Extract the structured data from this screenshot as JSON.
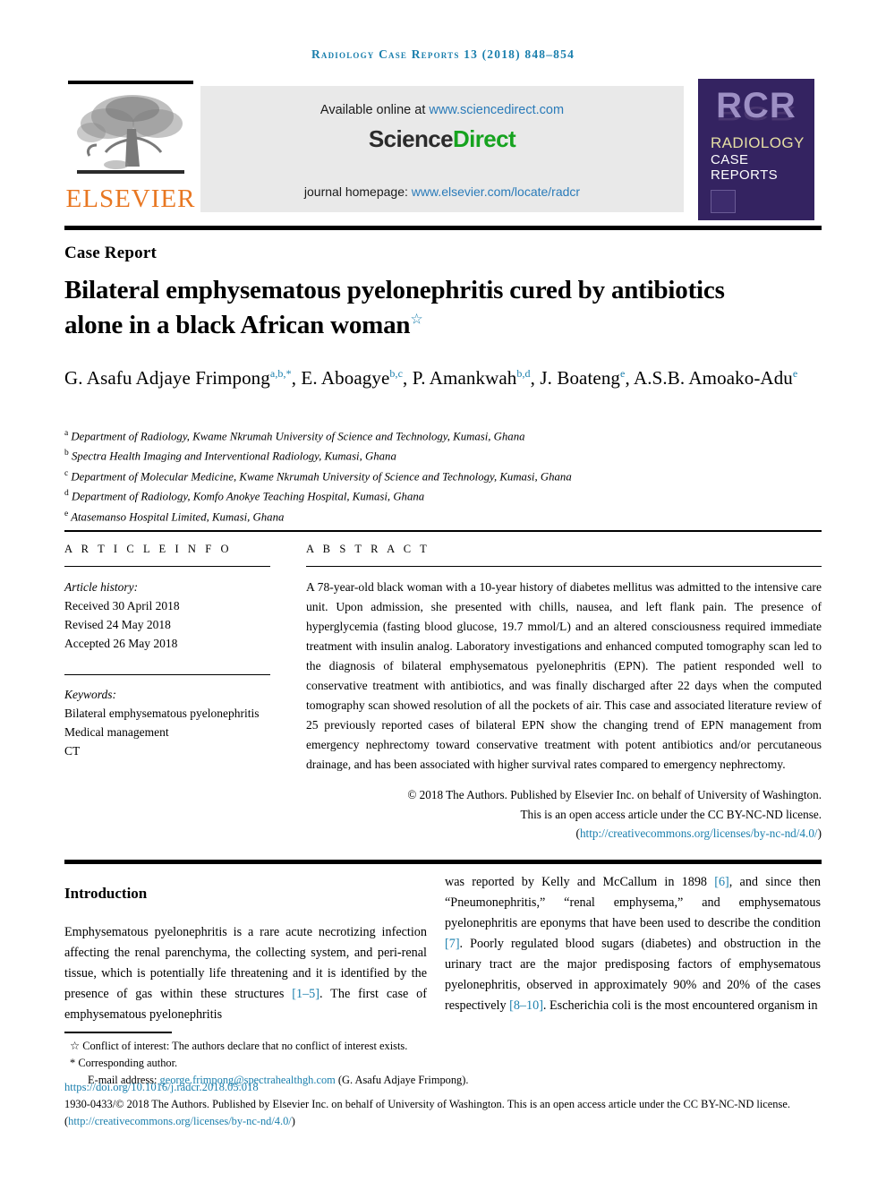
{
  "running_head": "Radiology Case Reports 13 (2018) 848–854",
  "masthead": {
    "elsevier_wordmark": "ELSEVIER",
    "sciencedirect": {
      "available_prefix": "Available online at ",
      "available_link": "www.sciencedirect.com",
      "logo_first": "Science",
      "logo_second": "Direct",
      "homepage_prefix": "journal homepage: ",
      "homepage_link": "www.elsevier.com/locate/radcr"
    },
    "cover": {
      "acronym": "RCR",
      "line1": "RADIOLOGY",
      "line2": "CASE",
      "line3": "REPORTS",
      "bg_color": "#342361",
      "acronym_color": "#9d8fc4",
      "line1_color": "#e6dfa4"
    }
  },
  "article": {
    "doc_type": "Case Report",
    "title": "Bilateral emphysematous pyelonephritis cured by antibiotics alone in a black African woman",
    "title_marker": "☆",
    "authors": [
      {
        "name": "G. Asafu Adjaye Frimpong",
        "marks": "a,b,*"
      },
      {
        "name": "E. Aboagye",
        "marks": "b,c"
      },
      {
        "name": "P. Amankwah",
        "marks": "b,d"
      },
      {
        "name": "J. Boateng",
        "marks": "e"
      },
      {
        "name": "A.S.B. Amoako-Adu",
        "marks": "e"
      }
    ],
    "affiliations": [
      {
        "mark": "a",
        "text": "Department of Radiology, Kwame Nkrumah University of Science and Technology, Kumasi, Ghana"
      },
      {
        "mark": "b",
        "text": "Spectra Health Imaging and Interventional Radiology, Kumasi, Ghana"
      },
      {
        "mark": "c",
        "text": "Department of Molecular Medicine, Kwame Nkrumah University of Science and Technology, Kumasi, Ghana"
      },
      {
        "mark": "d",
        "text": "Department of Radiology, Komfo Anokye Teaching Hospital, Kumasi, Ghana"
      },
      {
        "mark": "e",
        "text": "Atasemanso Hospital Limited, Kumasi, Ghana"
      }
    ]
  },
  "article_info": {
    "heading": "A R T I C L E   I N F O",
    "history_label": "Article history:",
    "received": "Received 30 April 2018",
    "revised": "Revised 24 May 2018",
    "accepted": "Accepted 26 May 2018",
    "keywords_label": "Keywords:",
    "keywords": [
      "Bilateral emphysematous pyelonephritis",
      "Medical management",
      "CT"
    ]
  },
  "abstract": {
    "heading": "A B S T R A C T",
    "text": "A 78-year-old black woman with a 10-year history of diabetes mellitus was admitted to the intensive care unit. Upon admission, she presented with chills, nausea, and left flank pain. The presence of hyperglycemia (fasting blood glucose, 19.7 mmol/L) and an altered consciousness required immediate treatment with insulin analog. Laboratory investigations and enhanced computed tomography scan led to the diagnosis of bilateral emphysematous pyelonephritis (EPN). The patient responded well to conservative treatment with antibiotics, and was finally discharged after 22 days when the computed tomography scan showed resolution of all the pockets of air. This case and associated literature review of 25 previously reported cases of bilateral EPN show the changing trend of EPN management from emergency nephrectomy toward conservative treatment with potent antibiotics and/or percutaneous drainage, and has been associated with higher survival rates compared to emergency nephrectomy.",
    "copyright_line1": "© 2018 The Authors. Published by Elsevier Inc. on behalf of University of Washington.",
    "copyright_line2": "This is an open access article under the CC BY-NC-ND license.",
    "copyright_link_open": "(",
    "copyright_link": "http://creativecommons.org/licenses/by-nc-nd/4.0/",
    "copyright_link_close": ")"
  },
  "body": {
    "intro_heading": "Introduction",
    "left_col": {
      "part1": "Emphysematous pyelonephritis is a rare acute necrotizing infection affecting the renal parenchyma, the collecting system, and peri-renal tissue, which is potentially life threatening and it is identified by the presence of gas within these structures ",
      "cite1": "[1–5]",
      "part2": ". The first case of emphysematous pyelonephritis"
    },
    "right_col": {
      "part1": "was reported by Kelly and McCallum in 1898 ",
      "cite1": "[6]",
      "part2": ", and since then “Pneumonephritis,” “renal emphysema,” and emphysematous pyelonephritis are eponyms that have been used to describe the condition ",
      "cite2": "[7]",
      "part3": ". Poorly regulated blood sugars (diabetes) and obstruction in the urinary tract are the major predisposing factors of emphysematous pyelonephritis, observed in approximately 90% and 20% of the cases respectively ",
      "cite3": "[8–10]",
      "part4": ". Escherichia coli is the most encountered organism in"
    }
  },
  "footnotes": {
    "conflict_marker": "☆",
    "conflict": "Conflict of interest: The authors declare that no conflict of interest exists.",
    "corresponding_marker": "*",
    "corresponding": "Corresponding author.",
    "email_label": "E-mail address: ",
    "email": "george.frimpong@spectrahealthgh.com",
    "email_suffix": " (G. Asafu Adjaye Frimpong).",
    "doi": "https://doi.org/10.1016/j.radcr.2018.05.018",
    "issn_prefix": "1930-0433/© 2018 The Authors. Published by Elsevier Inc. on behalf of University of Washington. This is an open access article under the CC BY-NC-ND license. (",
    "issn_link": "http://creativecommons.org/licenses/by-nc-nd/4.0/",
    "issn_suffix": ")"
  },
  "colors": {
    "link": "#1a7fad",
    "elsevier_orange": "#e87722",
    "sciencedirect_green": "#16a31f",
    "cover_purple": "#342361"
  }
}
